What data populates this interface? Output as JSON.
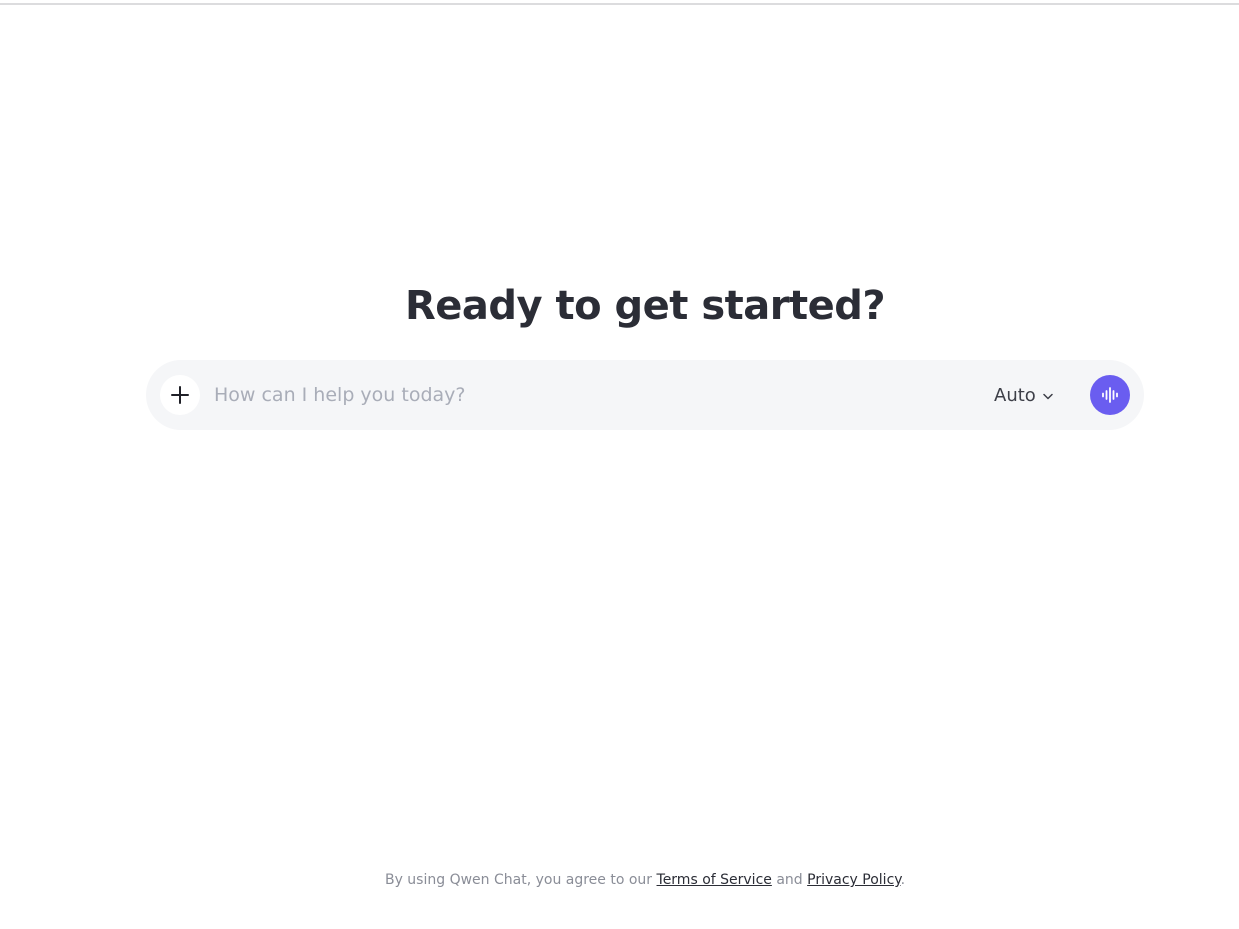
{
  "hero": {
    "title": "Ready to get started?"
  },
  "composer": {
    "placeholder": "How can I help you today?",
    "value": "",
    "add_icon": "plus-icon",
    "mode": {
      "selected": "Auto",
      "icon": "chevron-down-icon"
    },
    "voice_icon": "voice-wave-icon"
  },
  "footer": {
    "prefix": "By using Qwen Chat, you agree to our ",
    "terms_label": "Terms of Service",
    "and": " and ",
    "privacy_label": "Privacy Policy",
    "suffix": "."
  },
  "colors": {
    "accent": "#6a5df0",
    "composer_bg": "#f5f6f8",
    "title": "#2b2d36",
    "muted": "#8a8d97"
  }
}
